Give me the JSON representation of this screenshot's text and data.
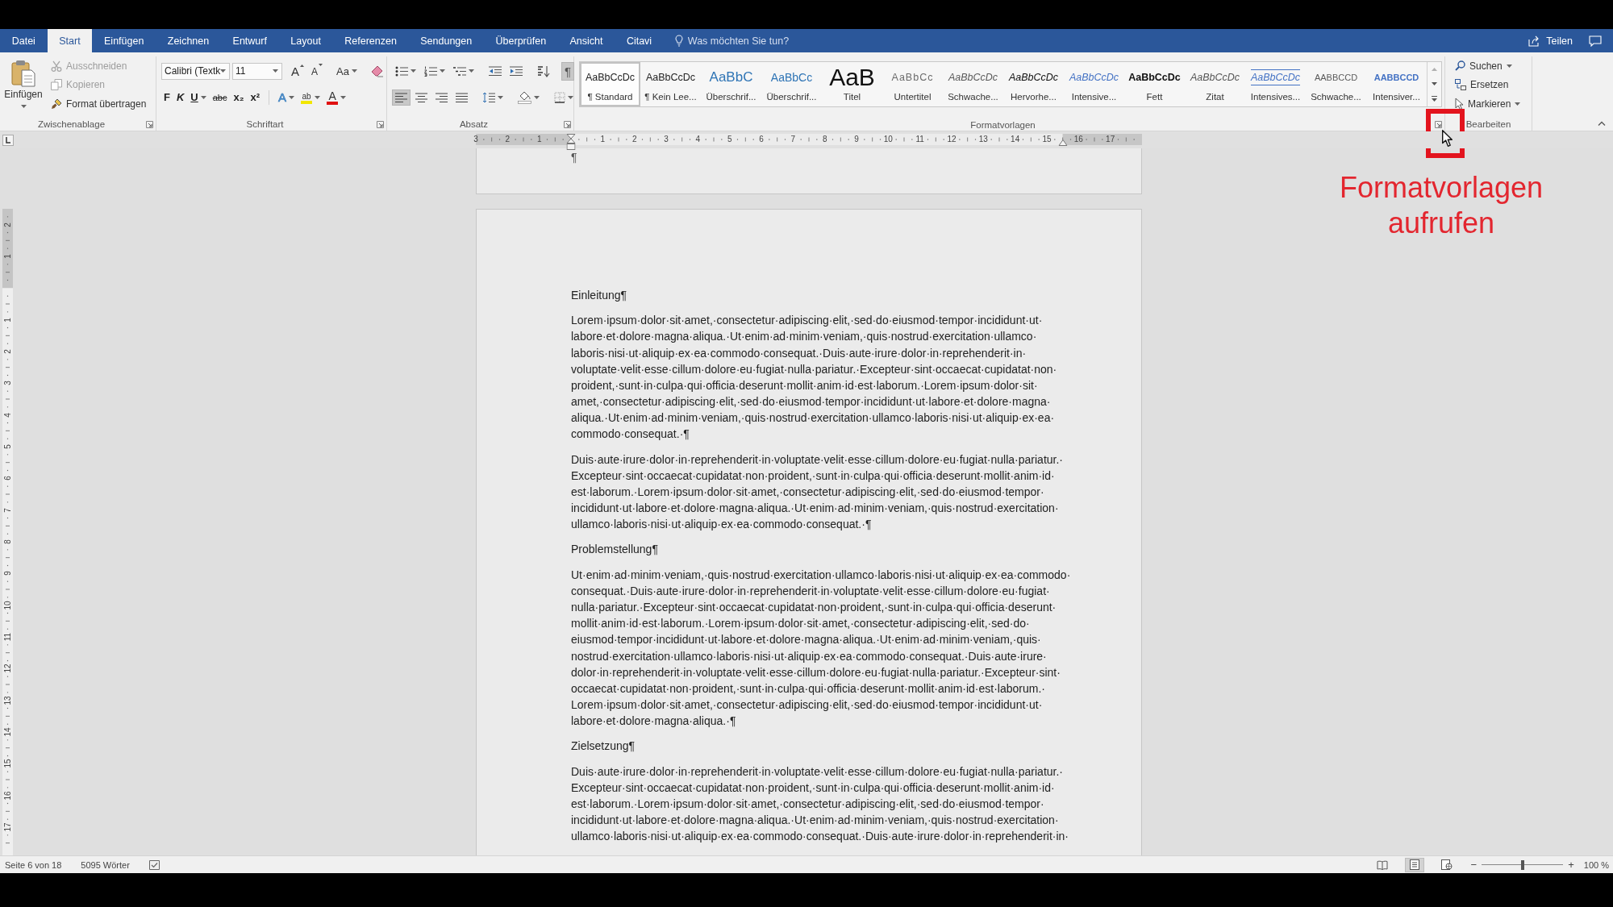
{
  "tabs": [
    {
      "label": "Datei",
      "selected": false
    },
    {
      "label": "Start",
      "selected": true
    },
    {
      "label": "Einfügen",
      "selected": false
    },
    {
      "label": "Zeichnen",
      "selected": false
    },
    {
      "label": "Entwurf",
      "selected": false
    },
    {
      "label": "Layout",
      "selected": false
    },
    {
      "label": "Referenzen",
      "selected": false
    },
    {
      "label": "Sendungen",
      "selected": false
    },
    {
      "label": "Überprüfen",
      "selected": false
    },
    {
      "label": "Ansicht",
      "selected": false
    },
    {
      "label": "Citavi",
      "selected": false
    }
  ],
  "tell_me": {
    "placeholder": "Was möchten Sie tun?"
  },
  "share": {
    "label": "Teilen"
  },
  "ribbon": {
    "clipboard": {
      "title": "Zwischenablage",
      "launcher": true,
      "paste": "Einfügen",
      "actions": [
        {
          "kind": "cut",
          "label": "Ausschneiden",
          "disabled": true
        },
        {
          "kind": "copy",
          "label": "Kopieren",
          "disabled": true
        },
        {
          "kind": "format-painter",
          "label": "Format übertragen",
          "disabled": false
        }
      ]
    },
    "font": {
      "title": "Schriftart",
      "launcher": true,
      "font_name": "Calibri (Textk",
      "font_size": "11",
      "row1": [
        {
          "kind": "grow",
          "label": "A"
        },
        {
          "kind": "shrink",
          "label": "A"
        },
        {
          "kind": "change-case",
          "label": "Aa"
        },
        {
          "kind": "clear-formatting"
        }
      ],
      "row2": [
        {
          "kind": "bold",
          "label": "F"
        },
        {
          "kind": "italic",
          "label": "K"
        },
        {
          "kind": "underline",
          "label": "U"
        },
        {
          "kind": "strikethrough",
          "label": "abc"
        },
        {
          "kind": "subscript",
          "label": "x₂"
        },
        {
          "kind": "superscript",
          "label": "x²"
        },
        {
          "kind": "text-effects",
          "label": "A"
        },
        {
          "kind": "highlight",
          "label": "ab",
          "color": "#f2e600"
        },
        {
          "kind": "font-color",
          "label": "A",
          "color": "#e01010"
        }
      ]
    },
    "paragraph": {
      "title": "Absatz",
      "launcher": true,
      "row1": [
        {
          "kind": "bullets",
          "pressed": false
        },
        {
          "kind": "numbering",
          "pressed": false
        },
        {
          "kind": "multilevel",
          "pressed": false
        },
        {
          "kind": "decrease-indent",
          "pressed": false
        },
        {
          "kind": "increase-indent",
          "pressed": false
        },
        {
          "kind": "sort",
          "pressed": false
        },
        {
          "kind": "show-marks",
          "label": "¶",
          "pressed": true
        }
      ],
      "row2": [
        {
          "kind": "align-left",
          "pressed": true
        },
        {
          "kind": "align-center",
          "pressed": false
        },
        {
          "kind": "align-right",
          "pressed": false
        },
        {
          "kind": "justify",
          "pressed": false
        },
        {
          "kind": "line-spacing",
          "pressed": false
        },
        {
          "kind": "shading",
          "pressed": false
        },
        {
          "kind": "borders",
          "pressed": false
        }
      ]
    },
    "styles": {
      "title": "Formatvorlagen",
      "launcher": true,
      "items": [
        {
          "kind": "normal",
          "preview": "AaBbCcDc",
          "label": "¶ Standard",
          "selected": true
        },
        {
          "kind": "no-spacing",
          "preview": "AaBbCcDc",
          "label": "¶ Kein Lee...",
          "selected": false
        },
        {
          "kind": "heading1",
          "preview": "AaBbC",
          "label": "Überschrif...",
          "selected": false
        },
        {
          "kind": "heading2",
          "preview": "AaBbCc",
          "label": "Überschrif...",
          "selected": false
        },
        {
          "kind": "title",
          "preview": "AaB",
          "label": "Titel",
          "selected": false
        },
        {
          "kind": "subtitle",
          "preview": "AaBbCc",
          "label": "Untertitel",
          "selected": false
        },
        {
          "kind": "subtle-emphasis",
          "preview": "AaBbCcDc",
          "label": "Schwache...",
          "selected": false
        },
        {
          "kind": "emphasis",
          "preview": "AaBbCcDc",
          "label": "Hervorhe...",
          "selected": false
        },
        {
          "kind": "intense-emphasis",
          "preview": "AaBbCcDc",
          "label": "Intensive...",
          "selected": false
        },
        {
          "kind": "strong",
          "preview": "AaBbCcDc",
          "label": "Fett",
          "selected": false
        },
        {
          "kind": "quote",
          "preview": "AaBbCcDc",
          "label": "Zitat",
          "selected": false
        },
        {
          "kind": "intense-quote",
          "preview": "AaBbCcDc",
          "label": "Intensives...",
          "selected": false
        },
        {
          "kind": "subtle-reference",
          "preview": "AABBCCD",
          "label": "Schwache...",
          "selected": false
        },
        {
          "kind": "intense-reference",
          "preview": "AABBCCD",
          "label": "Intensiver...",
          "selected": false
        }
      ]
    },
    "editing": {
      "title": "Bearbeiten",
      "launcher": false,
      "items": [
        {
          "kind": "find",
          "label": "Suchen"
        },
        {
          "kind": "replace",
          "label": "Ersetzen"
        },
        {
          "kind": "select",
          "label": "Markieren"
        }
      ]
    }
  },
  "rulers": {
    "horizontal": {
      "left_numbers": [
        "3",
        "2",
        "1"
      ],
      "numbers": [
        "1",
        "2",
        "3",
        "4",
        "5",
        "6",
        "7",
        "8",
        "9",
        "10",
        "11",
        "12",
        "13",
        "14",
        "15",
        "16",
        "17"
      ]
    },
    "vertical": {
      "top_numbers": [
        "2",
        "1"
      ],
      "numbers": [
        "1",
        "2",
        "3",
        "4",
        "5",
        "6",
        "7",
        "8",
        "9",
        "10",
        "11",
        "12",
        "13",
        "14",
        "15",
        "16",
        "17"
      ]
    }
  },
  "document": {
    "previous_page_end": "¶",
    "blocks": [
      {
        "kind": "heading",
        "text": "Einleitung¶"
      },
      {
        "kind": "body",
        "lines": [
          "Lorem·ipsum·dolor·sit·amet,·consectetur·adipiscing·elit,·sed·do·eiusmod·tempor·incididunt·ut·",
          "labore·et·dolore·magna·aliqua.·Ut·enim·ad·minim·veniam,·quis·nostrud·exercitation·ullamco·",
          "laboris·nisi·ut·aliquip·ex·ea·commodo·consequat.·Duis·aute·irure·dolor·in·reprehenderit·in·",
          "voluptate·velit·esse·cillum·dolore·eu·fugiat·nulla·pariatur.·Excepteur·sint·occaecat·cupidatat·non·",
          "proident,·sunt·in·culpa·qui·officia·deserunt·mollit·anim·id·est·laborum.·Lorem·ipsum·dolor·sit·",
          "amet,·consectetur·adipiscing·elit,·sed·do·eiusmod·tempor·incididunt·ut·labore·et·dolore·magna·",
          "aliqua.·Ut·enim·ad·minim·veniam,·quis·nostrud·exercitation·ullamco·laboris·nisi·ut·aliquip·ex·ea·",
          "commodo·consequat.·¶"
        ]
      },
      {
        "kind": "body",
        "lines": [
          "Duis·aute·irure·dolor·in·reprehenderit·in·voluptate·velit·esse·cillum·dolore·eu·fugiat·nulla·pariatur.·",
          "Excepteur·sint·occaecat·cupidatat·non·proident,·sunt·in·culpa·qui·officia·deserunt·mollit·anim·id·",
          "est·laborum.·Lorem·ipsum·dolor·sit·amet,·consectetur·adipiscing·elit,·sed·do·eiusmod·tempor·",
          "incididunt·ut·labore·et·dolore·magna·aliqua.·Ut·enim·ad·minim·veniam,·quis·nostrud·exercitation·",
          "ullamco·laboris·nisi·ut·aliquip·ex·ea·commodo·consequat.·¶"
        ]
      },
      {
        "kind": "heading",
        "text": "Problemstellung¶"
      },
      {
        "kind": "body",
        "lines": [
          "Ut·enim·ad·minim·veniam,·quis·nostrud·exercitation·ullamco·laboris·nisi·ut·aliquip·ex·ea·commodo·",
          "consequat.·Duis·aute·irure·dolor·in·reprehenderit·in·voluptate·velit·esse·cillum·dolore·eu·fugiat·",
          "nulla·pariatur.·Excepteur·sint·occaecat·cupidatat·non·proident,·sunt·in·culpa·qui·officia·deserunt·",
          "mollit·anim·id·est·laborum.·Lorem·ipsum·dolor·sit·amet,·consectetur·adipiscing·elit,·sed·do·",
          "eiusmod·tempor·incididunt·ut·labore·et·dolore·magna·aliqua.·Ut·enim·ad·minim·veniam,·quis·",
          "nostrud·exercitation·ullamco·laboris·nisi·ut·aliquip·ex·ea·commodo·consequat.·Duis·aute·irure·",
          "dolor·in·reprehenderit·in·voluptate·velit·esse·cillum·dolore·eu·fugiat·nulla·pariatur.·Excepteur·sint·",
          "occaecat·cupidatat·non·proident,·sunt·in·culpa·qui·officia·deserunt·mollit·anim·id·est·laborum.·",
          "Lorem·ipsum·dolor·sit·amet,·consectetur·adipiscing·elit,·sed·do·eiusmod·tempor·incididunt·ut·",
          "labore·et·dolore·magna·aliqua.·¶"
        ]
      },
      {
        "kind": "heading",
        "text": "Zielsetzung¶"
      },
      {
        "kind": "body",
        "lines": [
          "Duis·aute·irure·dolor·in·reprehenderit·in·voluptate·velit·esse·cillum·dolore·eu·fugiat·nulla·pariatur.·",
          "Excepteur·sint·occaecat·cupidatat·non·proident,·sunt·in·culpa·qui·officia·deserunt·mollit·anim·id·",
          "est·laborum.·Lorem·ipsum·dolor·sit·amet,·consectetur·adipiscing·elit,·sed·do·eiusmod·tempor·",
          "incididunt·ut·labore·et·dolore·magna·aliqua.·Ut·enim·ad·minim·veniam,·quis·nostrud·exercitation·",
          "ullamco·laboris·nisi·ut·aliquip·ex·ea·commodo·consequat.·Duis·aute·irure·dolor·in·reprehenderit·in·"
        ]
      }
    ]
  },
  "status_bar": {
    "page": "Seite 6 von 18",
    "words": "5095 Wörter",
    "views": [
      {
        "kind": "read",
        "selected": false
      },
      {
        "kind": "print",
        "selected": true
      },
      {
        "kind": "web",
        "selected": false
      }
    ],
    "zoom": {
      "minus": "−",
      "plus": "+",
      "level": 0.5,
      "label": "100 %"
    }
  },
  "annotation": {
    "text": "Formatvorlagen aufrufen"
  }
}
